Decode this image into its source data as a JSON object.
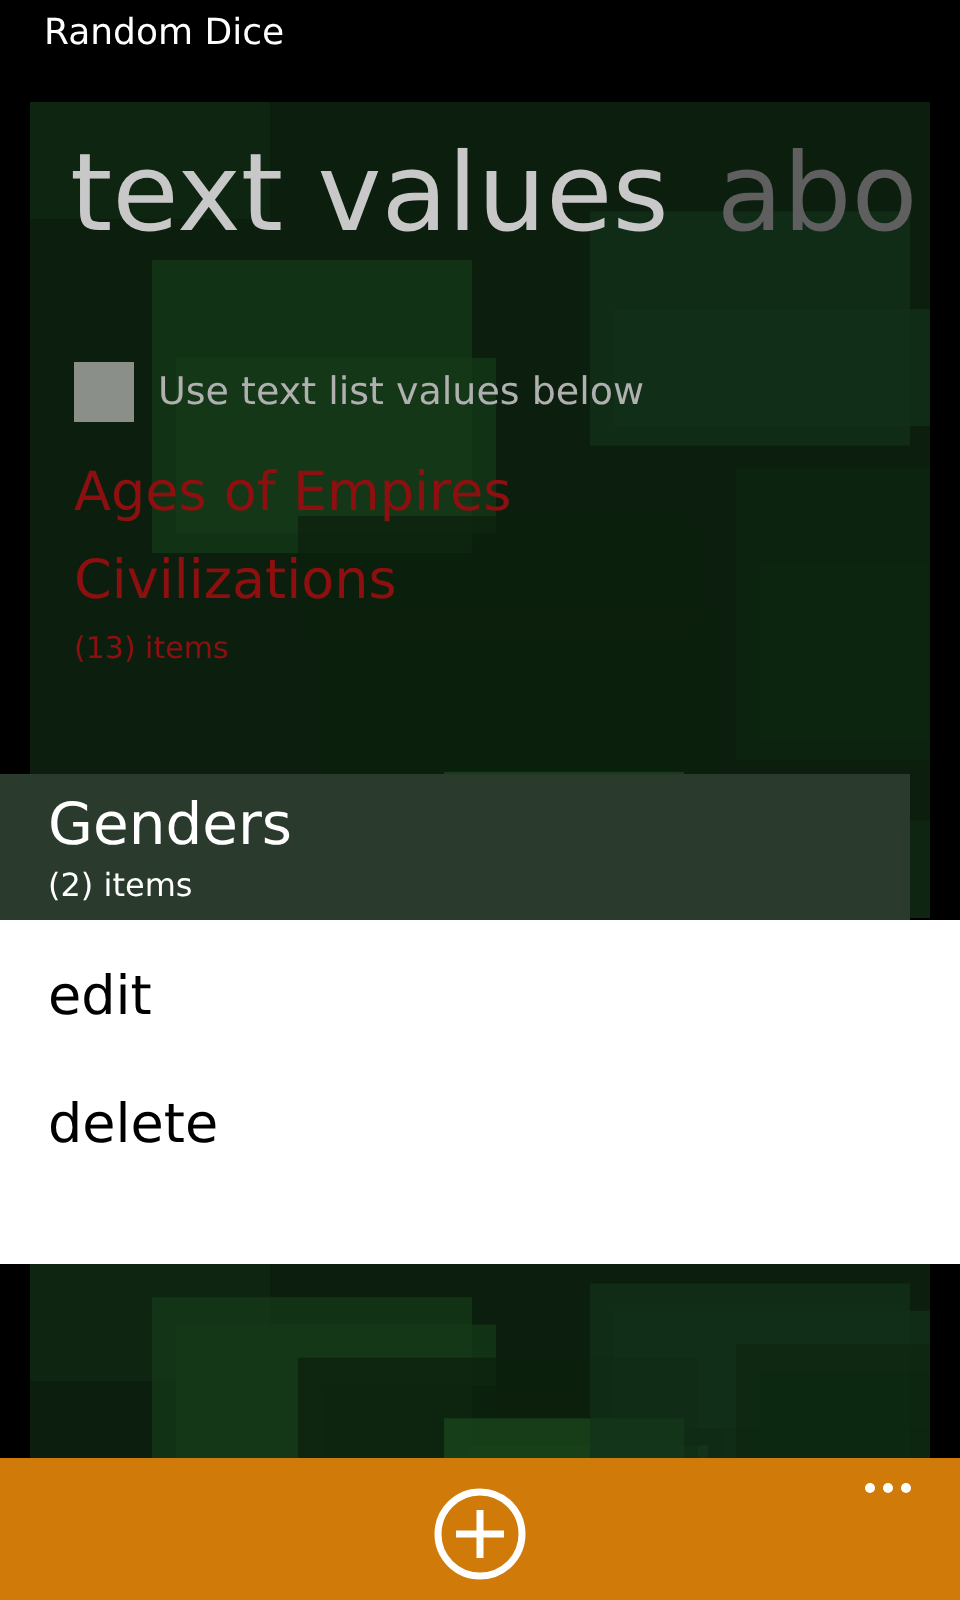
{
  "status_title": "Random Dice",
  "pivot": [
    {
      "label": "text values",
      "selected": true
    },
    {
      "label": "abo",
      "selected": false
    }
  ],
  "use_text_list": {
    "label": "Use text list values below",
    "checked": false
  },
  "lists": [
    {
      "name": "Ages of Empires Civilizations",
      "count": "(13) items",
      "selected": false
    },
    {
      "name": "Genders",
      "count": "(2) items",
      "selected": true
    }
  ],
  "context_menu": [
    "edit",
    "delete"
  ]
}
